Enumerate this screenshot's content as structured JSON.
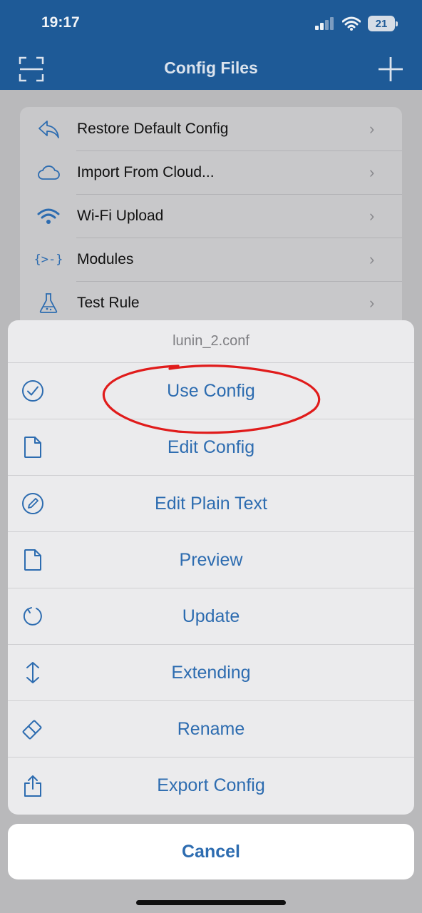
{
  "status_bar": {
    "time": "19:17",
    "battery": "21"
  },
  "nav": {
    "title": "Config Files",
    "left_icon": "scan-icon",
    "right_icon": "plus-icon"
  },
  "menu": {
    "items": [
      {
        "label": "Restore Default Config",
        "icon": "undo-arrow-icon"
      },
      {
        "label": "Import From Cloud...",
        "icon": "cloud-icon"
      },
      {
        "label": "Wi-Fi Upload",
        "icon": "wifi-icon"
      },
      {
        "label": "Modules",
        "icon": "braces-icon"
      },
      {
        "label": "Test Rule",
        "icon": "flask-icon"
      }
    ]
  },
  "sheet": {
    "title": "lunin_2.conf",
    "actions": [
      {
        "label": "Use Config",
        "icon": "checkmark-circle-icon"
      },
      {
        "label": "Edit Config",
        "icon": "document-icon"
      },
      {
        "label": "Edit Plain Text",
        "icon": "pencil-circle-icon"
      },
      {
        "label": "Preview",
        "icon": "document-icon"
      },
      {
        "label": "Update",
        "icon": "refresh-icon"
      },
      {
        "label": "Extending",
        "icon": "up-down-arrow-icon"
      },
      {
        "label": "Rename",
        "icon": "eraser-icon"
      },
      {
        "label": "Export Config",
        "icon": "share-icon"
      }
    ],
    "cancel_label": "Cancel"
  },
  "colors": {
    "nav_background": "#1e5a97",
    "action_text": "#2d6cb0",
    "annotation_circle": "#e01b1b"
  }
}
